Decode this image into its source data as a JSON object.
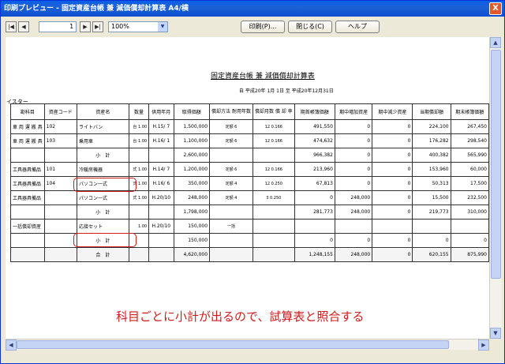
{
  "window": {
    "title": "印刷プレビュー - 固定資産台帳 兼 減価償却計算表 A4/横",
    "close_label": "X"
  },
  "toolbar": {
    "first_label": "|◀",
    "prev_label": "◀",
    "page_value": "1",
    "next_label": "▶",
    "last_label": "▶|",
    "zoom_value": "100%",
    "print_label": "印刷(P)...",
    "close_label": "閉じる(C)",
    "help_label": "ヘルプ"
  },
  "document": {
    "title": "固定資産台帳 兼 減価償却計算表",
    "period": "自 平成20年 1月 1日  至 平成20年12月31日",
    "company": "イスター",
    "headers": [
      "勘科目",
      "資産コード",
      "資産名",
      "数量",
      "供用年月",
      "取得価額",
      "償却方法 耐用年数",
      "償却月数 償 却 率",
      "期首帳簿価額",
      "期中増加資産",
      "期中減少資産",
      "当期償却額",
      "期末帳簿価額"
    ],
    "rows": [
      {
        "account": "車 両 運 搬 具",
        "code": "102",
        "name": "ライトバン",
        "qty": "台 1.00",
        "date": "H.15/ 7",
        "cost": "1,500,000",
        "method": "定額 6",
        "rate": "12 0.166",
        "opening": "491,550",
        "increase": "0",
        "decrease": "0",
        "depr": "224,100",
        "closing": "267,450"
      },
      {
        "account": "車 両 運 搬 具",
        "code": "103",
        "name": "乗用車",
        "qty": "台 1.00",
        "date": "H.16/ 1",
        "cost": "1,100,000",
        "method": "定額 6",
        "rate": "12 0.166",
        "opening": "474,632",
        "increase": "0",
        "decrease": "0",
        "depr": "176,282",
        "closing": "298,540"
      },
      {
        "account": "",
        "code": "",
        "name": "小　計",
        "qty": "",
        "date": "",
        "cost": "2,600,000",
        "method": "",
        "rate": "",
        "opening": "966,382",
        "increase": "0",
        "decrease": "0",
        "depr": "400,382",
        "closing": "565,990"
      },
      {
        "account": "工具器具備品",
        "code": "101",
        "name": "冷暖房機器",
        "qty": "式 1.00",
        "date": "H.14/ 7",
        "cost": "1,200,000",
        "method": "定額 6",
        "rate": "12 0.166",
        "opening": "213,960",
        "increase": "0",
        "decrease": "0",
        "depr": "153,960",
        "closing": "60,000"
      },
      {
        "account": "工具器具備品",
        "code": "104",
        "name": "パソコン一式",
        "qty": "式 1.00",
        "date": "H.16/ 6",
        "cost": "350,000",
        "method": "定額 4",
        "rate": "12 0.250",
        "opening": "67,813",
        "increase": "0",
        "decrease": "0",
        "depr": "50,313",
        "closing": "17,500"
      },
      {
        "account": "工具器具備品",
        "code": "",
        "name": "パソコン一式",
        "qty": "式 1.00",
        "date": "H.20/10",
        "cost": "248,000",
        "method": "定額 4",
        "rate": "3 0.250",
        "opening": "0",
        "increase": "248,000",
        "decrease": "0",
        "depr": "15,500",
        "closing": "232,500"
      },
      {
        "account": "",
        "code": "",
        "name": "小　計",
        "qty": "",
        "date": "",
        "cost": "1,798,000",
        "method": "",
        "rate": "",
        "opening": "281,773",
        "increase": "248,000",
        "decrease": "0",
        "depr": "219,773",
        "closing": "310,000"
      },
      {
        "account": "一括償却資産",
        "code": "",
        "name": "応接セット",
        "qty": "1.00",
        "date": "H.20/10",
        "cost": "150,000",
        "method": "一括",
        "rate": "",
        "opening": "",
        "increase": "",
        "decrease": "",
        "depr": "",
        "closing": ""
      },
      {
        "account": "",
        "code": "",
        "name": "小　計",
        "qty": "",
        "date": "",
        "cost": "150,000",
        "method": "",
        "rate": "",
        "opening": "0",
        "increase": "0",
        "decrease": "0",
        "depr": "0",
        "closing": "0"
      },
      {
        "account": "",
        "code": "",
        "name": "合　計",
        "qty": "",
        "date": "",
        "cost": "4,620,000",
        "method": "",
        "rate": "",
        "opening": "1,248,155",
        "increase": "248,000",
        "decrease": "0",
        "depr": "620,155",
        "closing": "875,990"
      }
    ]
  },
  "annotation": {
    "text": "科目ごとに小計が出るので、試算表と照合する",
    "color": "#d21b1b"
  },
  "colors": {
    "titlebar": "#0a5ee8",
    "window_bg": "#ece9d8",
    "highlight": "#d21b1b"
  }
}
